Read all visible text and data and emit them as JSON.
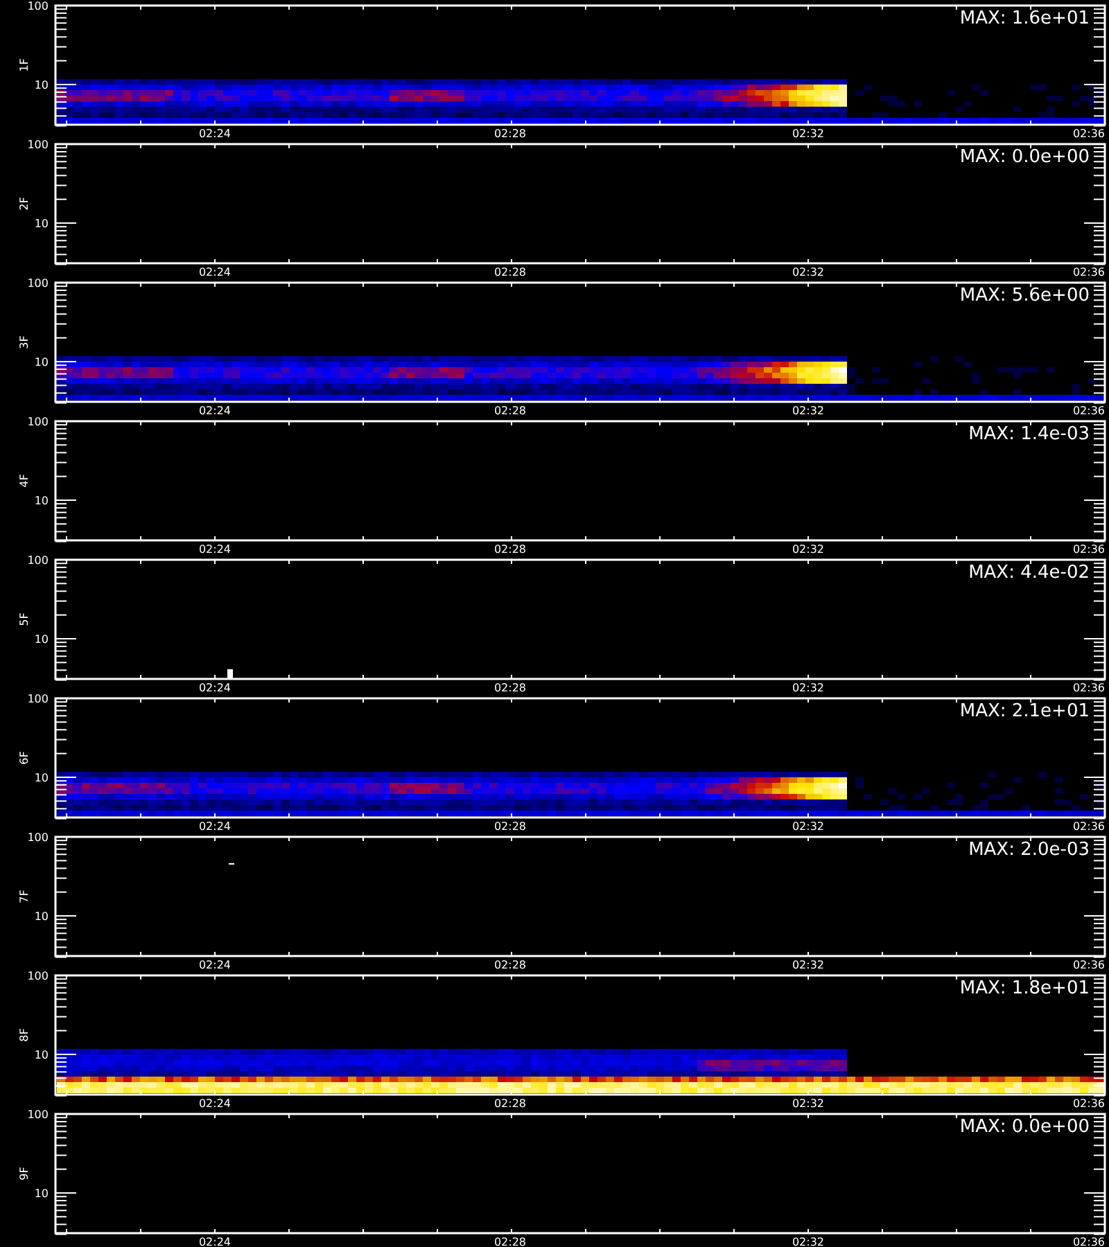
{
  "panels": [
    {
      "label": "1F",
      "max": "MAX: 1.6e+01",
      "kind": "band",
      "y_tick_labels": [
        "100",
        "10"
      ],
      "x_tick_labels": [
        "02:24",
        "02:28",
        "02:32",
        "02:36"
      ]
    },
    {
      "label": "2F",
      "max": "MAX: 0.0e+00",
      "kind": "empty",
      "y_tick_labels": [
        "100",
        "10"
      ],
      "x_tick_labels": [
        "02:24",
        "02:28",
        "02:32",
        "02:36"
      ]
    },
    {
      "label": "3F",
      "max": "MAX: 5.6e+00",
      "kind": "band",
      "y_tick_labels": [
        "100",
        "10"
      ],
      "x_tick_labels": [
        "02:24",
        "02:28",
        "02:32",
        "02:36"
      ]
    },
    {
      "label": "4F",
      "max": "MAX: 1.4e-03",
      "kind": "empty",
      "y_tick_labels": [
        "100",
        "10"
      ],
      "x_tick_labels": [
        "02:24",
        "02:28",
        "02:32",
        "02:36"
      ]
    },
    {
      "label": "5F",
      "max": "MAX: 4.4e-02",
      "kind": "low_speck",
      "y_tick_labels": [
        "100",
        "10"
      ],
      "x_tick_labels": [
        "02:24",
        "02:28",
        "02:32",
        "02:36"
      ]
    },
    {
      "label": "6F",
      "max": "MAX: 2.1e+01",
      "kind": "band",
      "y_tick_labels": [
        "100",
        "10"
      ],
      "x_tick_labels": [
        "02:24",
        "02:28",
        "02:32",
        "02:36"
      ]
    },
    {
      "label": "7F",
      "max": "MAX: 2.0e-03",
      "kind": "high_speck",
      "y_tick_labels": [
        "100",
        "10"
      ],
      "x_tick_labels": [
        "02:24",
        "02:28",
        "02:32",
        "02:36"
      ]
    },
    {
      "label": "8F",
      "max": "MAX: 1.8e+01",
      "kind": "saturated",
      "y_tick_labels": [
        "100",
        "10"
      ],
      "x_tick_labels": [
        "02:24",
        "02:28",
        "02:32",
        "02:36"
      ]
    },
    {
      "label": "9F",
      "max": "MAX: 0.0e+00",
      "kind": "empty",
      "y_tick_labels": [
        "100",
        "10"
      ],
      "x_tick_labels": [
        "02:24",
        "02:28",
        "02:32",
        "02:36"
      ]
    }
  ]
}
